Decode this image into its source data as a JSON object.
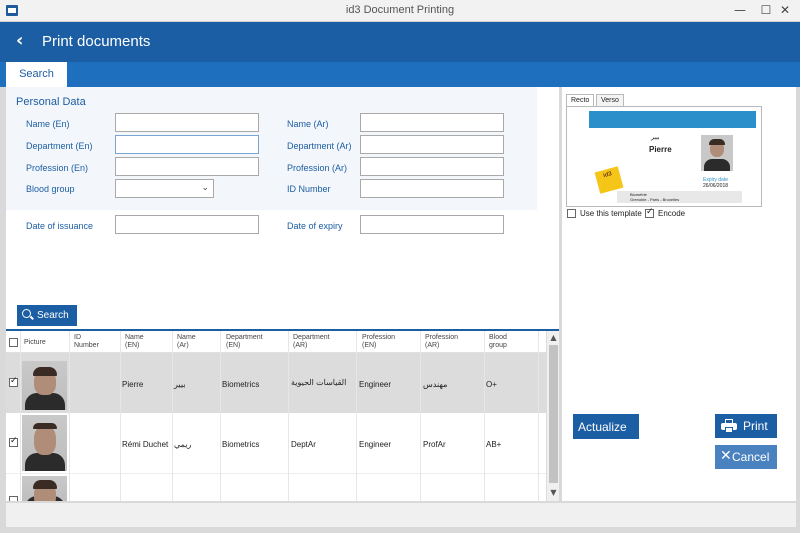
{
  "window": {
    "title": "id3 Document Printing",
    "minimize": "—",
    "maximize": "☐",
    "close": "✕"
  },
  "header": {
    "title": "Print documents",
    "back_icon": "back-arrow-icon"
  },
  "tabs": [
    {
      "label": "Search"
    }
  ],
  "personal": {
    "section_title": "Personal Data",
    "name_en": "Name (En)",
    "name_ar": "Name (Ar)",
    "dept_en": "Department (En)",
    "dept_ar": "Department (Ar)",
    "prof_en": "Profession (En)",
    "prof_ar": "Profession (Ar)",
    "blood": "Blood group",
    "id_number": "ID Number",
    "issuance": "Date of issuance",
    "expiry": "Date of expiry"
  },
  "search_button": "Search",
  "table": {
    "headers": {
      "picture": "Picture",
      "id1": "ID",
      "id2": "Number",
      "name_en1": "Name",
      "name_en2": "(EN)",
      "name_ar1": "Name",
      "name_ar2": "(Ar)",
      "dept_en1": "Department",
      "dept_en2": "(EN)",
      "dept_ar1": "Department",
      "dept_ar2": "(AR)",
      "prof_en1": "Profession",
      "prof_en2": "(EN)",
      "prof_ar1": "Profession",
      "prof_ar2": "(AR)",
      "blood1": "Blood",
      "blood2": "group"
    },
    "rows": [
      {
        "selected": true,
        "id": "",
        "name_en": "Pierre",
        "name_ar": "بيير",
        "dept_en": "Biometrics",
        "dept_ar": "القياسات الحيوية",
        "prof_en": "Engineer",
        "prof_ar": "مهندس",
        "blood": "O+"
      },
      {
        "selected": true,
        "id": "",
        "name_en": "Rémi Duchet",
        "name_ar": "ريمي",
        "dept_en": "Biometrics",
        "dept_ar": "DeptAr",
        "prof_en": "Engineer",
        "prof_ar": "ProfAr",
        "blood": "AB+"
      },
      {
        "selected": false,
        "id": "",
        "name_en": "",
        "name_ar": "",
        "dept_en": "",
        "dept_ar": "",
        "prof_en": "",
        "prof_ar": "",
        "blood": ""
      }
    ]
  },
  "preview": {
    "tab_recto": "Recto",
    "tab_verso": "Verso",
    "card_ar_name": "بيير",
    "card_name": "Pierre",
    "expiry_label": "Expiry date",
    "expiry_value": "26/06/2018",
    "logo_text": "id3",
    "strip_line1": "Biométrie",
    "strip_line2": "Grenoble - Paris - Bruxelles",
    "use_template": "Use this template",
    "encode": "Encode"
  },
  "buttons": {
    "actualize": "Actualize",
    "print": "Print",
    "cancel": "Cancel"
  },
  "colors": {
    "header": "#1c5ea3",
    "tabstrip": "#1f6fbf",
    "accent": "#1c5ea3",
    "selected_row": "#dcdcdc"
  }
}
